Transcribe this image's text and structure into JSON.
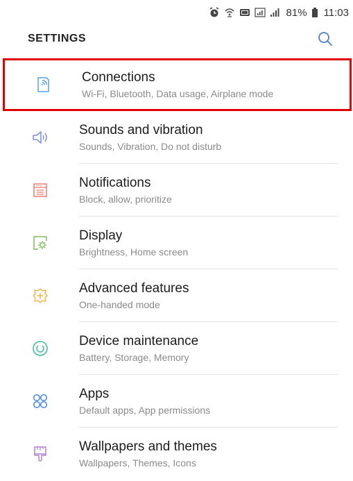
{
  "status_bar": {
    "icons": [
      "alarm-icon",
      "wifi-calling-icon",
      "cast-icon",
      "hd-signal-icon",
      "signal-icon"
    ],
    "battery_percent": "81%",
    "time": "11:03"
  },
  "header": {
    "title": "SETTINGS",
    "search_icon": "search-icon"
  },
  "colors": {
    "highlight_border": "#e00000",
    "connections_icon": "#56a3e0",
    "sounds_icon": "#7b8be6",
    "notifications_icon": "#ef7b6e",
    "display_icon": "#7fbf5a",
    "advanced_icon": "#f3b33b",
    "maintenance_icon": "#39b9a2",
    "apps_icon": "#4a8ce0",
    "wallpapers_icon": "#b67fd8"
  },
  "settings": [
    {
      "id": "connections",
      "title": "Connections",
      "subtitle": "Wi-Fi, Bluetooth, Data usage, Airplane mode",
      "icon": "connections-icon",
      "highlighted": true
    },
    {
      "id": "sounds",
      "title": "Sounds and vibration",
      "subtitle": "Sounds, Vibration, Do not disturb",
      "icon": "speaker-icon"
    },
    {
      "id": "notifications",
      "title": "Notifications",
      "subtitle": "Block, allow, prioritize",
      "icon": "notifications-icon"
    },
    {
      "id": "display",
      "title": "Display",
      "subtitle": "Brightness, Home screen",
      "icon": "display-icon"
    },
    {
      "id": "advanced",
      "title": "Advanced features",
      "subtitle": "One-handed mode",
      "icon": "advanced-features-icon"
    },
    {
      "id": "maintenance",
      "title": "Device maintenance",
      "subtitle": "Battery, Storage, Memory",
      "icon": "device-maintenance-icon"
    },
    {
      "id": "apps",
      "title": "Apps",
      "subtitle": "Default apps, App permissions",
      "icon": "apps-icon"
    },
    {
      "id": "wallpapers",
      "title": "Wallpapers and themes",
      "subtitle": "Wallpapers, Themes, Icons",
      "icon": "paint-brush-icon"
    }
  ]
}
